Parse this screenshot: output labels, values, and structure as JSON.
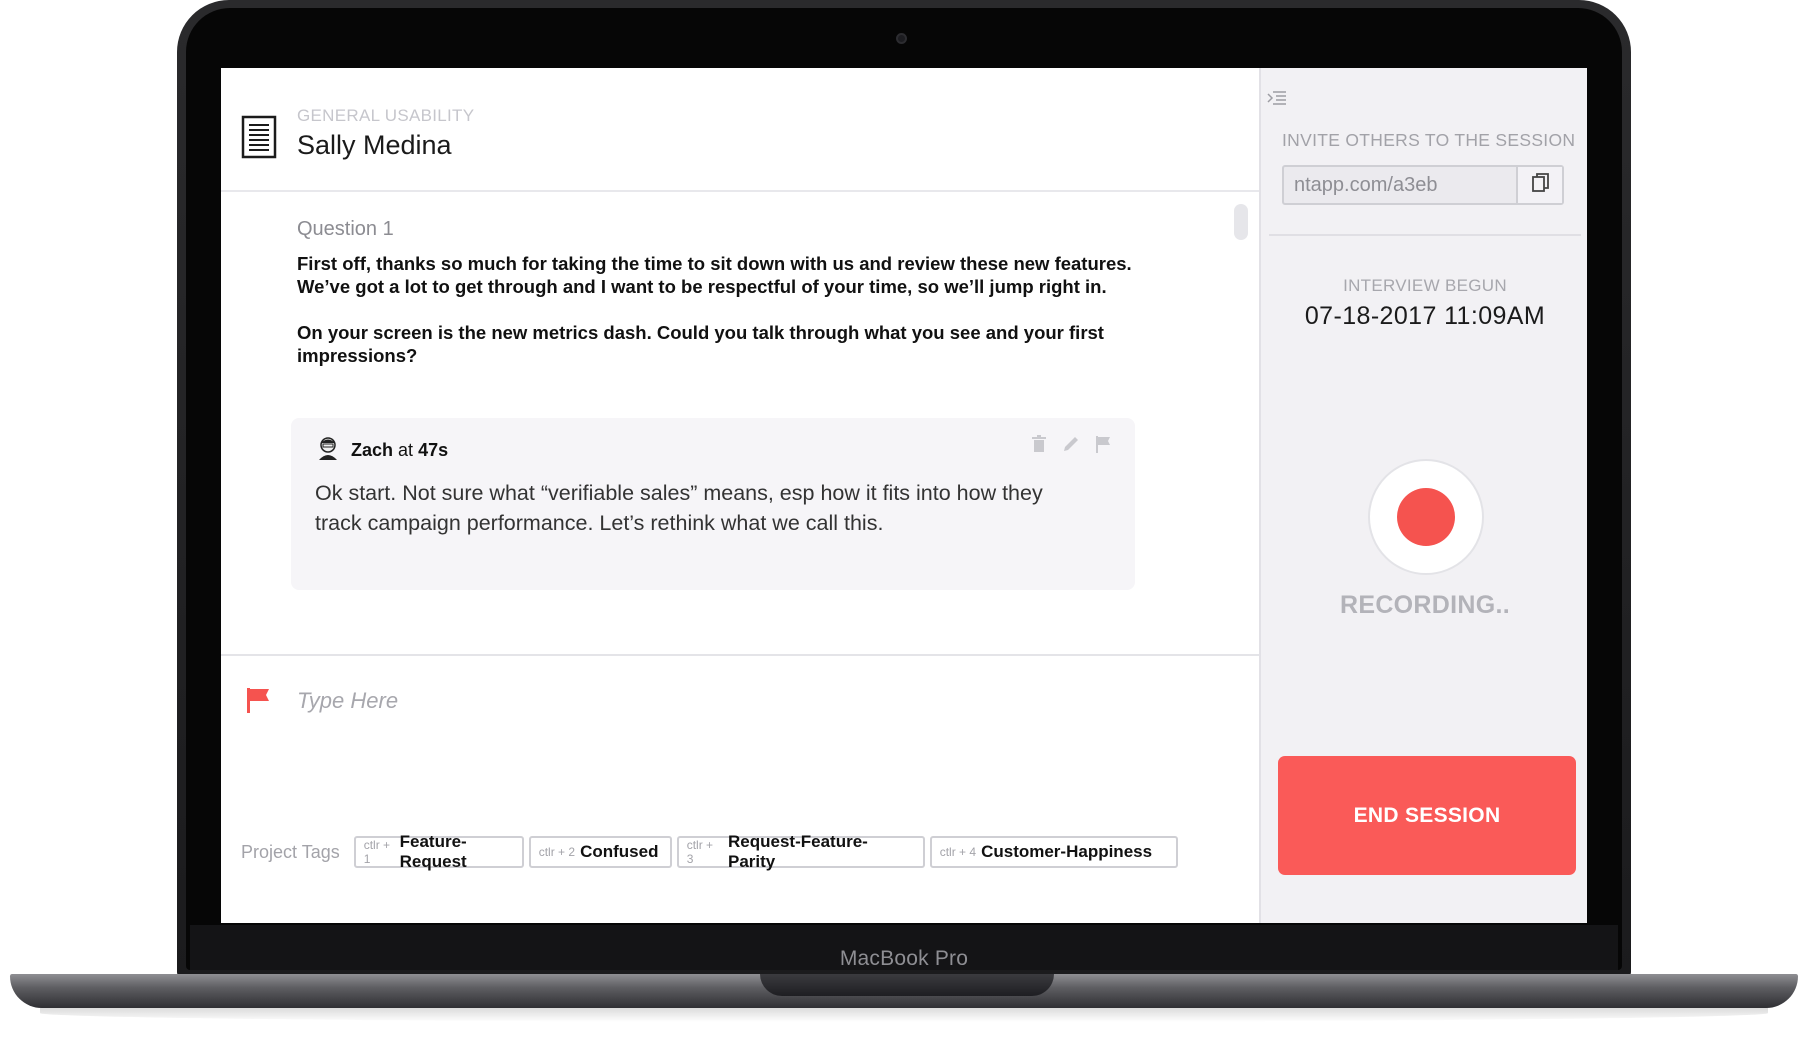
{
  "header": {
    "category": "GENERAL USABILITY",
    "title": "Sally Medina"
  },
  "question": {
    "label": "Question 1",
    "paragraphs": [
      "First off, thanks so much for taking the time to sit down with us and review these new features. We’ve got a lot to get through and I want to be respectful of your time, so we’ll jump right in.",
      "On your screen is the new metrics dash. Could you talk through what you see and your first impressions?"
    ]
  },
  "note": {
    "author": "Zach",
    "at": "at",
    "time": "47s",
    "text": "Ok start. Not sure what “verifiable sales” means, esp how it fits into how they track campaign performance. Let’s rethink what we call this.",
    "tools": [
      "trash-icon",
      "pencil-icon",
      "flag-icon"
    ]
  },
  "compose": {
    "placeholder": "Type Here"
  },
  "tags": {
    "label": "Project Tags",
    "items": [
      {
        "shortcut": "ctlr + 1",
        "name": "Feature-Request"
      },
      {
        "shortcut": "ctlr + 2",
        "name": "Confused"
      },
      {
        "shortcut": "ctlr + 3",
        "name": "Request-Feature-Parity"
      },
      {
        "shortcut": "ctlr + 4",
        "name": "Customer-Happiness"
      }
    ]
  },
  "sidebar": {
    "invite_label": "INVITE OTHERS TO THE SESSION",
    "invite_url": "ntapp.com/a3eb",
    "begun_label": "INTERVIEW BEGUN",
    "begun_time": "07-18-2017  11:09AM",
    "recording_label": "RECORDING..",
    "end_label": "END SESSION"
  },
  "device": {
    "brand": "MacBook Pro"
  },
  "colors": {
    "accent_red": "#fa5a58",
    "record_red": "#f5534f",
    "sidebar_bg": "#f2f1f4"
  }
}
